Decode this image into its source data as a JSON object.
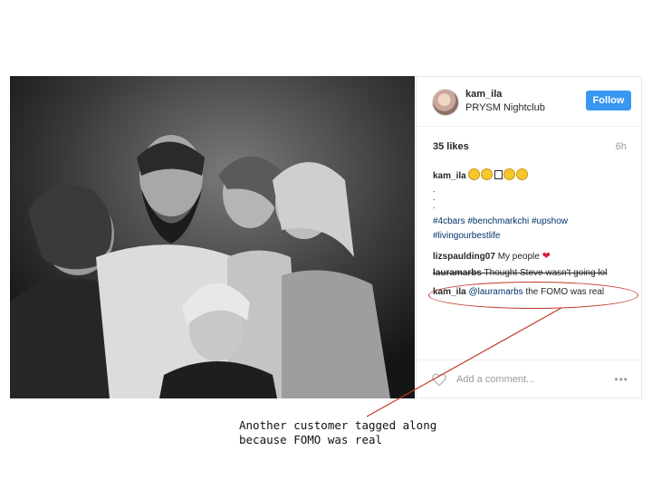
{
  "post": {
    "username": "kam_ila",
    "location": "PRYSM Nightclub",
    "follow_label": "Follow",
    "likes": "35 likes",
    "time": "6h",
    "caption_user": "kam_ila",
    "hashtags_line1": "#4cbars #benchmarkchi #upshow",
    "hashtags_line2": "#livingourbestlife",
    "comments": [
      {
        "user": "lizspaulding07",
        "text": "My people"
      },
      {
        "user": "lauramarbs",
        "text": "Thought Steve wasn't going lol"
      },
      {
        "user": "kam_ila",
        "mention": "@lauramarbs",
        "text": "the FOMO was real"
      }
    ],
    "add_comment_placeholder": "Add a comment...",
    "more_label": "•••"
  },
  "annotation": {
    "line1": "Another customer tagged along",
    "line2": "because FOMO was real"
  },
  "colors": {
    "follow_button": "#3897f0",
    "hashtag": "#003569",
    "heart": "#d6203c",
    "annotation": "#c0392b"
  },
  "icons": [
    "heart-icon",
    "chick-emoji-icon",
    "heart-outline-icon",
    "more-options-icon"
  ]
}
